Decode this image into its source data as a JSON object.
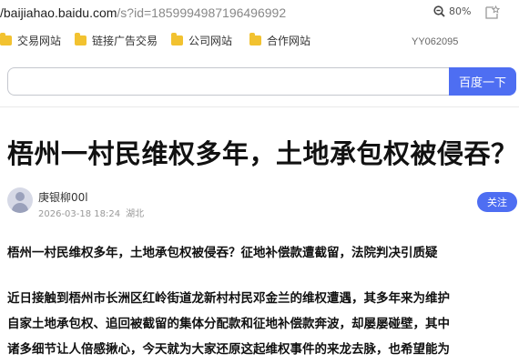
{
  "browser": {
    "url_host": "baijiahao.baidu.com",
    "url_prefix": "/",
    "url_path": "/s?id=1859994987196496992",
    "zoom": "80%",
    "bookmarks": [
      "交易网站",
      "链接广告交易",
      "公司网站",
      "合作网站"
    ],
    "bookmark_code": "YY062095"
  },
  "search": {
    "value": "",
    "button_label": "百度一下"
  },
  "article": {
    "title": "梧州一村民维权多年，土地承包权被侵吞？",
    "author": "庚银柳00l",
    "date": "2026-03-18 18:24",
    "location": "湖北",
    "follow_label": "关注",
    "subtitle": "梧州一村民维权多年，土地承包权被侵吞？征地补偿款遭截留，法院判决引质疑",
    "paragraph_lines": [
      "近日接触到梧州市长洲区红岭街道龙新村村民邓金兰的维权遭遇，其多年来为维护",
      "自家土地承包权、追回被截留的集体分配款和征地补偿款奔波，却屡屡碰壁，其中",
      "诸多细节让人倍感揪心，今天就为大家还原这起维权事件的来龙去脉，也希望能为"
    ]
  },
  "colors": {
    "accent": "#4e6ef2",
    "folder": "#f2c230"
  }
}
